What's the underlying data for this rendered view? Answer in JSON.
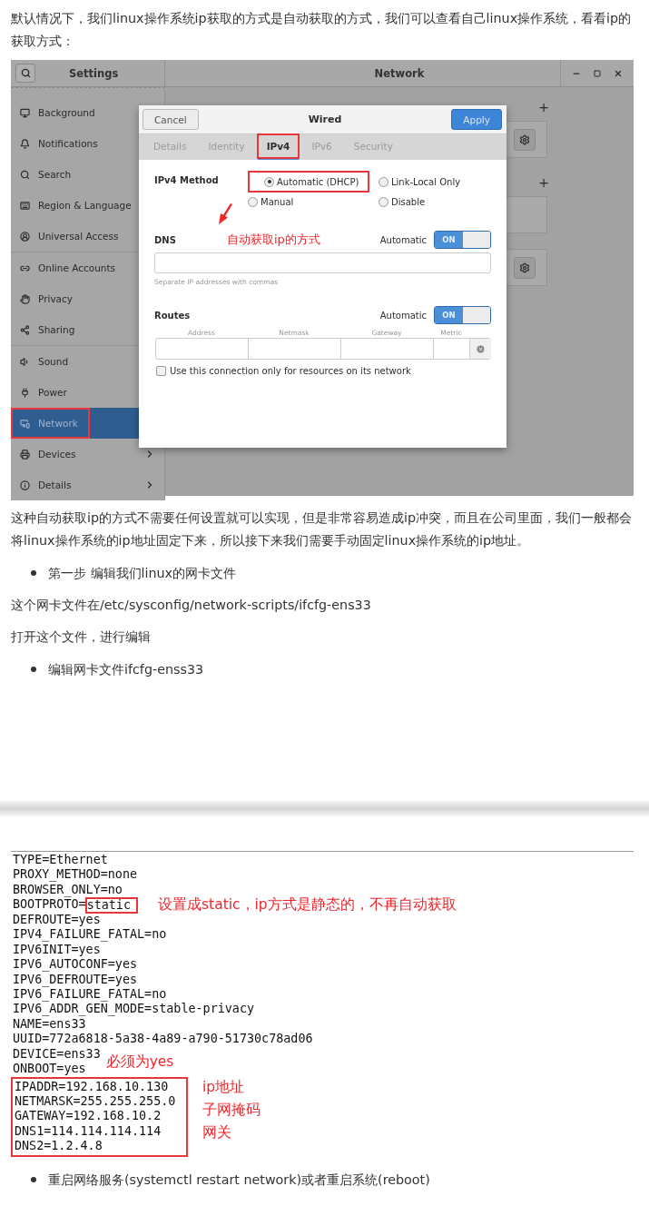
{
  "intro": "默认情况下，我们linux操作系统ip获取的方式是自动获取的方式，我们可以查看自己linux操作系统，看看ip的获取方式：",
  "settings_window": {
    "sidebar_title": "Settings",
    "title": "Network",
    "sidebar_groups": [
      [
        {
          "label": "Background",
          "selected": false,
          "highlighted": false,
          "chevron": false
        },
        {
          "label": "Notifications",
          "selected": false,
          "highlighted": false,
          "chevron": false
        },
        {
          "label": "Search",
          "selected": false,
          "highlighted": false,
          "chevron": false
        },
        {
          "label": "Region & Language",
          "selected": false,
          "highlighted": false,
          "chevron": false
        },
        {
          "label": "Universal Access",
          "selected": false,
          "highlighted": false,
          "chevron": false
        }
      ],
      [
        {
          "label": "Online Accounts",
          "selected": false,
          "highlighted": false,
          "chevron": false
        },
        {
          "label": "Privacy",
          "selected": false,
          "highlighted": false,
          "chevron": false
        },
        {
          "label": "Sharing",
          "selected": false,
          "highlighted": false,
          "chevron": false
        }
      ],
      [
        {
          "label": "Sound",
          "selected": false,
          "highlighted": false,
          "chevron": false
        },
        {
          "label": "Power",
          "selected": false,
          "highlighted": false,
          "chevron": false
        },
        {
          "label": "Network",
          "selected": true,
          "highlighted": true,
          "chevron": false
        },
        {
          "label": "Devices",
          "selected": false,
          "highlighted": false,
          "chevron": true
        },
        {
          "label": "Details",
          "selected": false,
          "highlighted": false,
          "chevron": true
        }
      ]
    ],
    "sections": [
      {
        "add": "+",
        "cards": [
          {
            "kind": "gear"
          }
        ]
      },
      {
        "add": "+",
        "cards": [
          {
            "kind": "plain"
          },
          {
            "kind": "gear"
          }
        ]
      }
    ],
    "dialog": {
      "cancel": "Cancel",
      "title": "Wired",
      "apply": "Apply",
      "tabs": [
        {
          "label": "Details",
          "selected": false,
          "highlighted": false
        },
        {
          "label": "Identity",
          "selected": false,
          "highlighted": false
        },
        {
          "label": "IPv4",
          "selected": true,
          "highlighted": true
        },
        {
          "label": "IPv6",
          "selected": false,
          "highlighted": false
        },
        {
          "label": "Security",
          "selected": false,
          "highlighted": false
        }
      ],
      "method_label": "IPv4 Method",
      "methods": [
        {
          "label": "Automatic (DHCP)",
          "selected": true,
          "highlighted": true
        },
        {
          "label": "Link-Local Only",
          "selected": false,
          "highlighted": false
        },
        {
          "label": "Manual",
          "selected": false,
          "highlighted": false
        },
        {
          "label": "Disable",
          "selected": false,
          "highlighted": false
        }
      ],
      "annotation": "自动获取ip的方式",
      "dns": {
        "label": "DNS",
        "auto_label": "Automatic",
        "switch": "ON",
        "on": true,
        "hint": "Separate IP addresses with commas"
      },
      "routes": {
        "label": "Routes",
        "auto_label": "Automatic",
        "switch": "ON",
        "on": true,
        "columns": [
          "Address",
          "Netmask",
          "Gateway",
          "Metric"
        ]
      },
      "checkbox": {
        "label": "Use this connection only for resources on its network",
        "checked": false
      }
    }
  },
  "paragraph": "这种自动获取ip的方式不需要任何设置就可以实现，但是非常容易造成ip冲突，而且在公司里面，我们一般都会将linux操作系统的ip地址固定下来，所以接下来我们需要手动固定linux操作系统的ip地址。",
  "step_bullet": "第一步 编辑我们linux的网卡文件",
  "file_path_text": "这个网卡文件在/etc/sysconfig/network-scripts/ifcfg-ens33",
  "open_text": "打开这个文件，进行编辑",
  "edit_bullet": "编辑网卡文件ifcfg-enss33",
  "code_lines": [
    {
      "text": "TYPE=Ethernet"
    },
    {
      "text": "PROXY_METHOD=none"
    },
    {
      "text": "BROWSER_ONLY=no"
    },
    {
      "text": "BOOTPROTO=",
      "boxed": "static",
      "note": "设置成static，ip方式是静态的，不再自动获取"
    },
    {
      "text": "DEFROUTE=yes"
    },
    {
      "text": "IPV4_FAILURE_FATAL=no"
    },
    {
      "text": "IPV6INIT=yes"
    },
    {
      "text": "IPV6_AUTOCONF=yes"
    },
    {
      "text": "IPV6_DEFROUTE=yes"
    },
    {
      "text": "IPV6_FAILURE_FATAL=no"
    },
    {
      "text": "IPV6_ADDR_GEN_MODE=stable-privacy"
    },
    {
      "text": "NAME=ens33"
    },
    {
      "text": "UUID=772a6818-5a38-4a89-a790-51730c78ad06"
    },
    {
      "text": "DEVICE=ens33"
    },
    {
      "text": "ONBOOT=yes",
      "note": "必须为yes"
    }
  ],
  "code_group": {
    "lines": [
      "IPADDR=192.168.10.130",
      "NETMARSK=255.255.255.0",
      "GATEWAY=192.168.10.2",
      "DNS1=114.114.114.114",
      "DNS2=1.2.4.8"
    ],
    "notes": [
      "ip地址",
      "子网掩码",
      "网关"
    ]
  },
  "restart_bullet": "重启网络服务(systemctl restart network)或者重启系统(reboot)"
}
